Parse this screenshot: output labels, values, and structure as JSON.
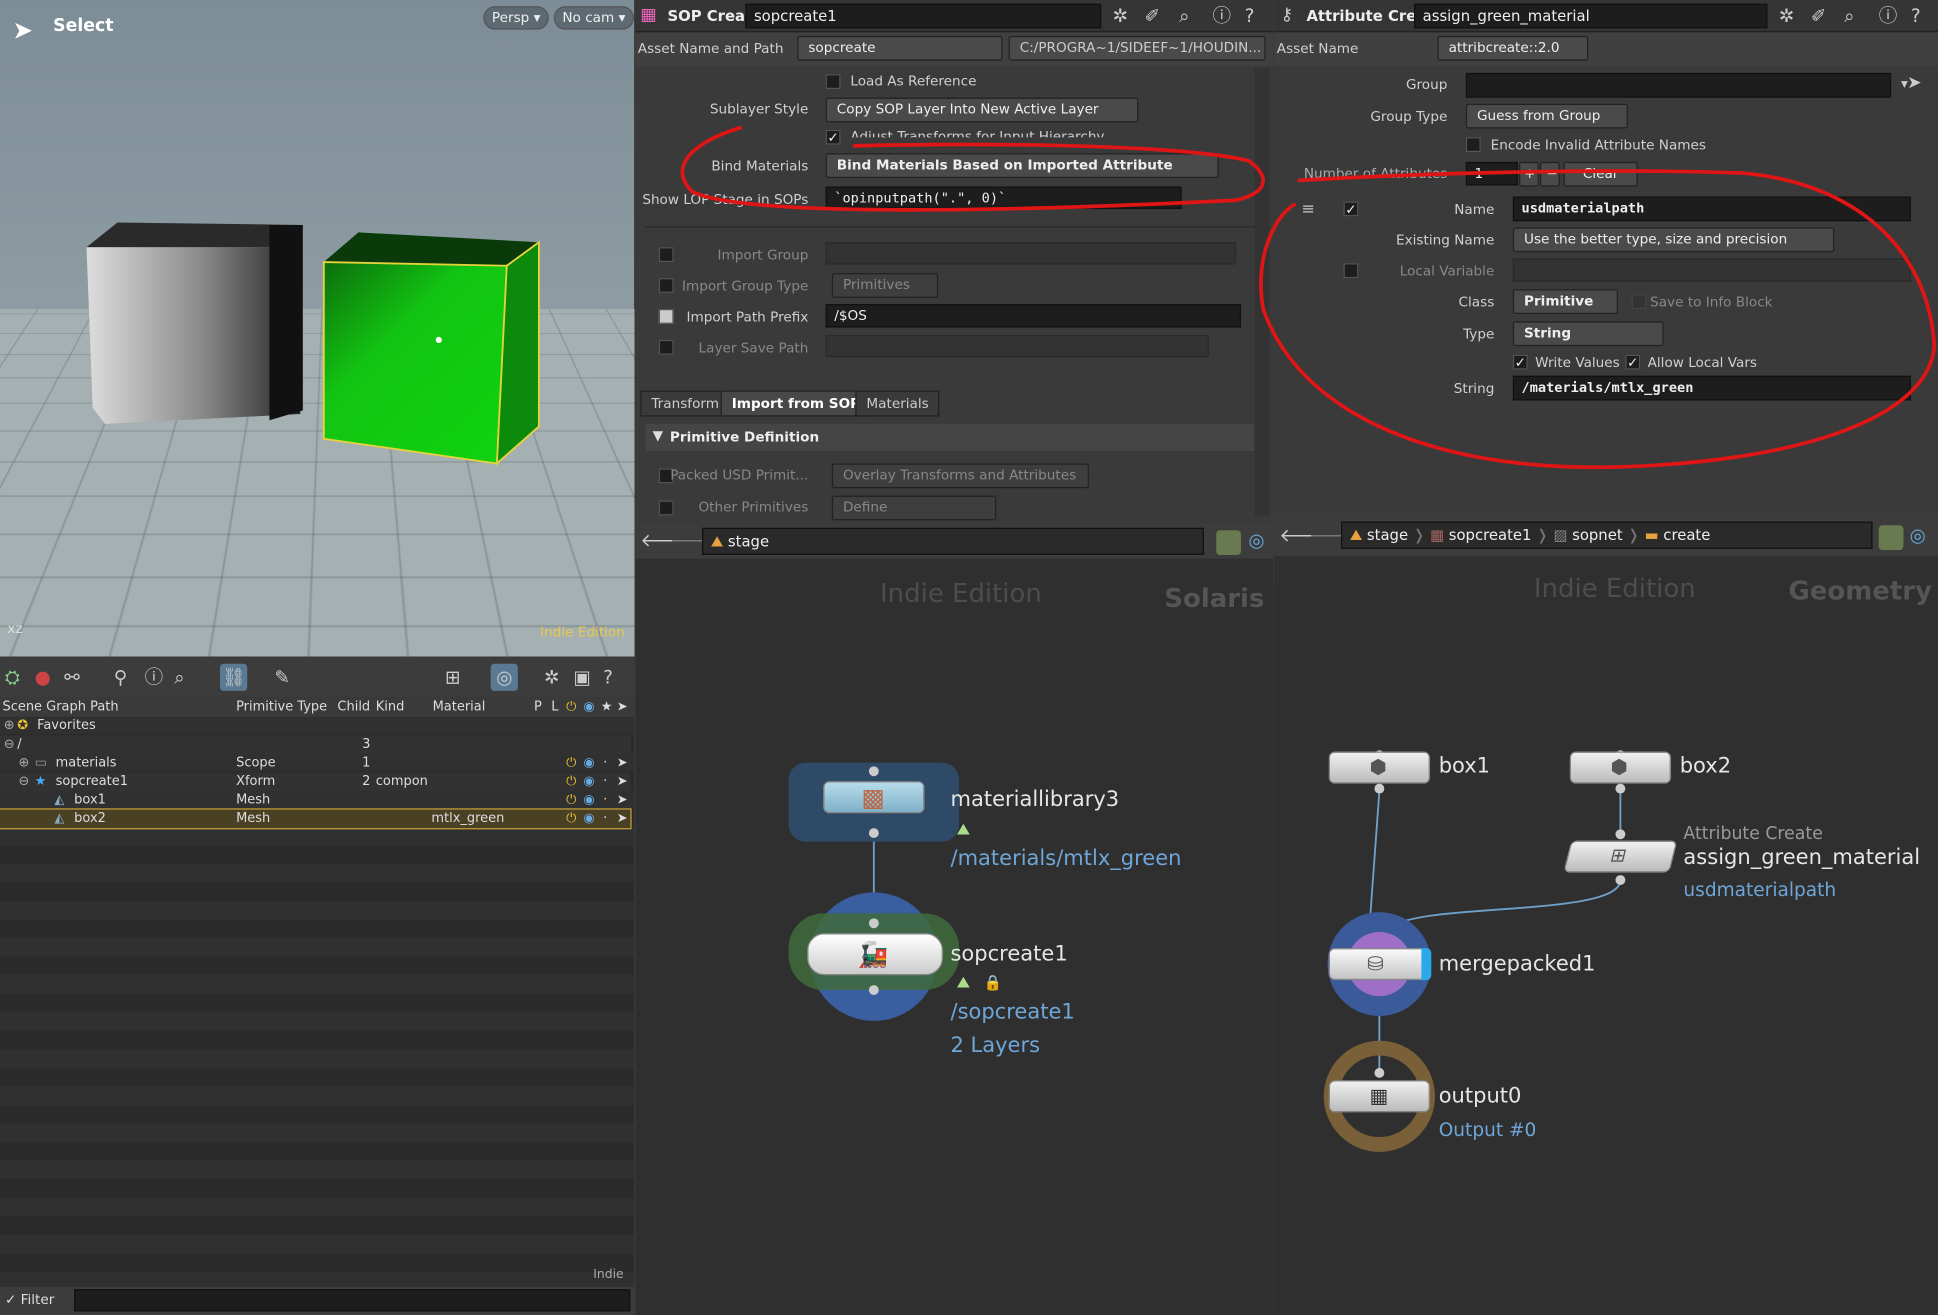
{
  "viewport": {
    "title": "Select",
    "persp_label": "Persp",
    "cam_label": "No cam",
    "edition": "Indie Edition",
    "axis": "xz"
  },
  "sop_create": {
    "header_type": "SOP Create",
    "node_name": "sopcreate1",
    "asset_label": "Asset Name and Path",
    "asset_name": "sopcreate",
    "asset_path": "C:/PROGRA~1/SIDEEF~1/HOUDIN...",
    "load_as_reference": "Load As Reference",
    "sublayer_label": "Sublayer Style",
    "sublayer_value": "Copy SOP Layer Into New Active Layer",
    "adjust_transforms": "Adjust Transforms for Input Hierarchy",
    "bind_label": "Bind Materials",
    "bind_value": "Bind Materials Based on Imported Attribute",
    "show_lop_label": "Show LOP Stage in SOPs",
    "show_lop_value": "`opinputpath(\".\", 0)`",
    "import_group_label": "Import Group",
    "import_group_type_label": "Import Group Type",
    "import_group_type_value": "Primitives",
    "import_prefix_label": "Import Path Prefix",
    "import_prefix_value": "/$OS",
    "layer_save_label": "Layer Save Path",
    "tabs": [
      "Transform",
      "Import from SOPs",
      "Materials"
    ],
    "section": "Primitive Definition",
    "packed_label": "Packed USD Primit...",
    "packed_value": "Overlay Transforms and Attributes",
    "other_label": "Other Primitives",
    "other_value": "Define"
  },
  "attrib_create": {
    "header_type": "Attribute Create",
    "node_name": "assign_green_material",
    "asset_label": "Asset Name",
    "asset_name": "attribcreate::2.0",
    "group_label": "Group",
    "group_type_label": "Group Type",
    "group_type_value": "Guess from Group",
    "encode_label": "Encode Invalid Attribute Names",
    "num_attr_label": "Number of Attributes",
    "num_attr_value": "1",
    "clear_label": "Clear",
    "name_label": "Name",
    "name_value": "usdmaterialpath",
    "existing_label": "Existing Name",
    "existing_value": "Use the better type, size and precision",
    "local_var_label": "Local Variable",
    "class_label": "Class",
    "class_value": "Primitive",
    "save_info_label": "Save to Info Block",
    "type_label": "Type",
    "type_value": "String",
    "write_values": "Write Values",
    "allow_local": "Allow Local Vars",
    "string_label": "String",
    "string_value": "/materials/mtlx_green"
  },
  "scene_graph": {
    "columns": [
      "Scene Graph Path",
      "Primitive Type",
      "Child",
      "Kind",
      "Material",
      "P",
      "L"
    ],
    "rows": [
      {
        "path": "Favorites",
        "type": "",
        "child": "",
        "kind": "",
        "material": ""
      },
      {
        "path": "/",
        "type": "",
        "child": "3",
        "kind": "",
        "material": ""
      },
      {
        "path": "materials",
        "type": "Scope",
        "child": "1",
        "kind": "",
        "material": ""
      },
      {
        "path": "sopcreate1",
        "type": "Xform",
        "child": "2",
        "kind": "compon",
        "material": ""
      },
      {
        "path": "box1",
        "type": "Mesh",
        "child": "",
        "kind": "",
        "material": ""
      },
      {
        "path": "box2",
        "type": "Mesh",
        "child": "",
        "kind": "",
        "material": "mtlx_green"
      }
    ],
    "indie": "Indie",
    "filter_label": "Filter"
  },
  "solaris_net": {
    "path": "stage",
    "watermark": "Indie Edition",
    "context": "Solaris",
    "nodes": [
      {
        "name": "materiallibrary3",
        "sub1": "/materials/mtlx_green"
      },
      {
        "name": "sopcreate1",
        "sub1": "/sopcreate1",
        "sub2": "2 Layers"
      }
    ]
  },
  "geo_net": {
    "crumbs": [
      "stage",
      "sopcreate1",
      "sopnet",
      "create"
    ],
    "watermark": "Indie Edition",
    "context": "Geometry",
    "nodes": {
      "box1": "box1",
      "box2": "box2",
      "attr_type": "Attribute Create",
      "attr_name": "assign_green_material",
      "attr_sub": "usdmaterialpath",
      "merge": "mergepacked1",
      "output": "output0",
      "output_sub": "Output #0"
    }
  }
}
